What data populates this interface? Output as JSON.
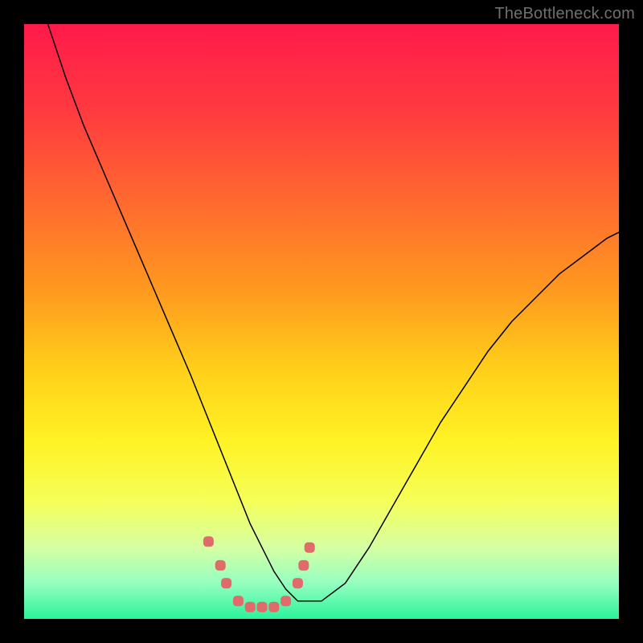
{
  "watermark": "TheBottleneck.com",
  "chart_data": {
    "type": "line",
    "title": "",
    "xlabel": "",
    "ylabel": "",
    "xlim": [
      0,
      100
    ],
    "ylim": [
      0,
      100
    ],
    "grid": false,
    "legend": false,
    "background_gradient": {
      "stops": [
        {
          "offset": 0.0,
          "color": "#ff1a4b"
        },
        {
          "offset": 0.15,
          "color": "#ff3b3f"
        },
        {
          "offset": 0.3,
          "color": "#ff6a2f"
        },
        {
          "offset": 0.45,
          "color": "#ff9a1f"
        },
        {
          "offset": 0.58,
          "color": "#ffcf1a"
        },
        {
          "offset": 0.7,
          "color": "#fff224"
        },
        {
          "offset": 0.8,
          "color": "#f6ff57"
        },
        {
          "offset": 0.88,
          "color": "#d6ffa3"
        },
        {
          "offset": 0.94,
          "color": "#95ffc0"
        },
        {
          "offset": 1.0,
          "color": "#2bf39a"
        }
      ]
    },
    "series": [
      {
        "name": "curve",
        "type": "line",
        "stroke": "#000000",
        "stroke_width": 1.5,
        "x": [
          4,
          7,
          10,
          13,
          16,
          19,
          22,
          25,
          28,
          30,
          32,
          34,
          36,
          38,
          40,
          42,
          44,
          46,
          50,
          54,
          58,
          62,
          66,
          70,
          74,
          78,
          82,
          86,
          90,
          94,
          98,
          100
        ],
        "y": [
          100,
          91,
          83,
          76,
          69,
          62,
          55,
          48,
          41,
          36,
          31,
          26,
          21,
          16,
          12,
          8,
          5,
          3,
          3,
          6,
          12,
          19,
          26,
          33,
          39,
          45,
          50,
          54,
          58,
          61,
          64,
          65
        ]
      },
      {
        "name": "markers",
        "type": "scatter",
        "marker_color": "#e16a6a",
        "marker_size": 13,
        "x": [
          31,
          33,
          34,
          36,
          38,
          40,
          42,
          44,
          46,
          47,
          48
        ],
        "y": [
          13,
          9,
          6,
          3,
          2,
          2,
          2,
          3,
          6,
          9,
          12
        ]
      }
    ]
  }
}
